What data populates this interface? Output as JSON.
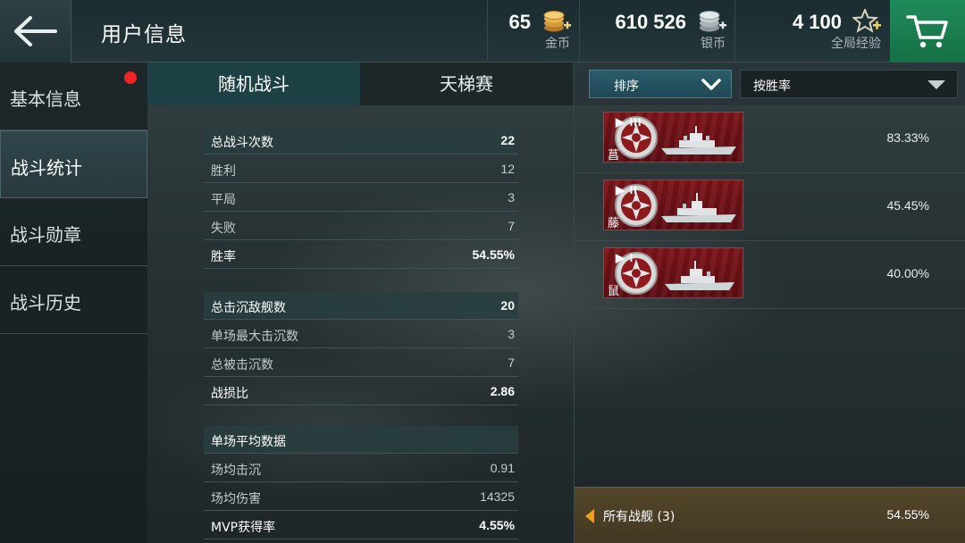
{
  "header": {
    "title": "用户信息",
    "back_icon": "back-arrow-icon",
    "currencies": [
      {
        "amount": "65",
        "label": "金币",
        "icon": "gold-coin-icon"
      },
      {
        "amount": "610 526",
        "label": "银币",
        "icon": "silver-coin-icon"
      },
      {
        "amount": "4 100",
        "label": "全局经验",
        "icon": "star-exp-icon"
      }
    ],
    "cart_icon": "cart-icon",
    "cart_color": "#1f8a5a"
  },
  "sidebar": {
    "items": [
      {
        "label": "基本信息",
        "has_notification": true
      },
      {
        "label": "战斗统计",
        "active": true
      },
      {
        "label": "战斗勋章"
      },
      {
        "label": "战斗历史"
      }
    ]
  },
  "tabs": [
    {
      "label": "随机战斗",
      "active": true
    },
    {
      "label": "天梯赛",
      "active": false
    }
  ],
  "stats": {
    "battles": {
      "header": {
        "label": "总战斗次数",
        "value": "22"
      },
      "rows": [
        {
          "label": "胜利",
          "value": "12"
        },
        {
          "label": "平局",
          "value": "3"
        },
        {
          "label": "失败",
          "value": "7"
        },
        {
          "label": "胜率",
          "value": "54.55%"
        }
      ]
    },
    "kills": {
      "header": {
        "label": "总击沉敌舰数",
        "value": "20"
      },
      "rows": [
        {
          "label": "单场最大击沉数",
          "value": "3"
        },
        {
          "label": "总被击沉数",
          "value": "7"
        },
        {
          "label": "战损比",
          "value": "2.86"
        }
      ]
    },
    "average": {
      "header": {
        "label": "单场平均数据"
      },
      "rows": [
        {
          "label": "场均击沉",
          "value": "0.91"
        },
        {
          "label": "场均伤害",
          "value": "14325"
        },
        {
          "label": "MVP获得率",
          "value": "4.55%"
        }
      ]
    }
  },
  "right": {
    "sort_button": "排序",
    "sort_option": "按胜率",
    "ships": [
      {
        "name": "菖",
        "tier": "III",
        "winrate": "83.33%"
      },
      {
        "name": "藤",
        "tier": "II",
        "winrate": "45.45%"
      },
      {
        "name": "鼠",
        "tier": "I",
        "winrate": "40.00%"
      }
    ],
    "footer": {
      "label": "所有战舰 (3)",
      "value": "54.55%"
    },
    "card_color": "#7d1419",
    "footer_accent": "#f0a020"
  }
}
